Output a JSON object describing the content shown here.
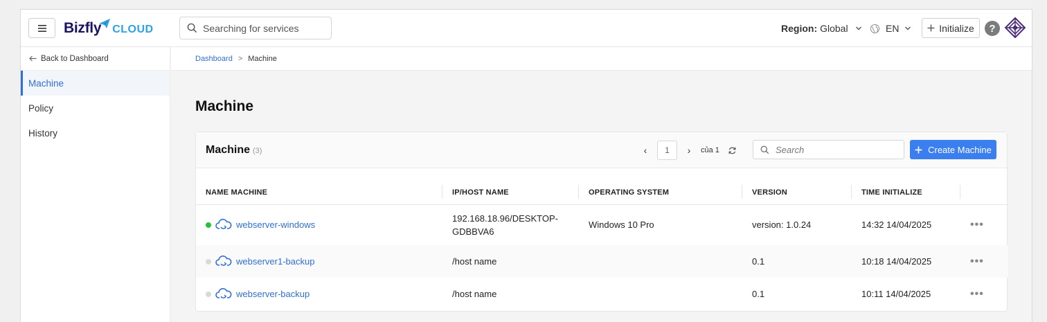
{
  "header": {
    "logo_main": "Bizfly",
    "logo_sub": "CLOUD",
    "search_placeholder": "Searching for services",
    "region_label": "Region:",
    "region_value": "Global",
    "language": "EN",
    "initialize_label": "Initialize",
    "help_label": "?"
  },
  "sidebar": {
    "back_label": "Back to Dashboard",
    "items": [
      {
        "label": "Machine",
        "active": true
      },
      {
        "label": "Policy",
        "active": false
      },
      {
        "label": "History",
        "active": false
      }
    ]
  },
  "breadcrumb": {
    "root": "Dashboard",
    "separator": ">",
    "current": "Machine"
  },
  "page_title": "Machine",
  "card": {
    "title": "Machine",
    "count": "(3)",
    "pager": {
      "prev": "‹",
      "page": "1",
      "next": "›",
      "of_text": "của 1"
    },
    "search_placeholder": "Search",
    "create_label": "Create Machine",
    "columns": [
      "NAME MACHINE",
      "IP/HOST NAME",
      "OPERATING SYSTEM",
      "VERSION",
      "TIME INITIALIZE"
    ],
    "rows": [
      {
        "status": "online",
        "status_color": "#22c33a",
        "name": "webserver-windows",
        "host": "192.168.18.96/DESKTOP-GDBBVA6",
        "os": "Windows 10 Pro",
        "version": "version: 1.0.24",
        "time": "14:32 14/04/2025",
        "actions": "•••"
      },
      {
        "status": "offline",
        "status_color": "#d9d9d9",
        "name": "webserver1-backup",
        "host": "/host name",
        "os": "",
        "version": "0.1",
        "time": "10:18 14/04/2025",
        "actions": "•••"
      },
      {
        "status": "offline",
        "status_color": "#d9d9d9",
        "name": "webserver-backup",
        "host": "/host name",
        "os": "",
        "version": "0.1",
        "time": "10:11 14/04/2025",
        "actions": "•••"
      }
    ]
  },
  "colors": {
    "accent": "#3a7ef0",
    "link": "#2f6fd6",
    "brand_dark": "#1a1460",
    "brand_light": "#2ba3e6"
  }
}
